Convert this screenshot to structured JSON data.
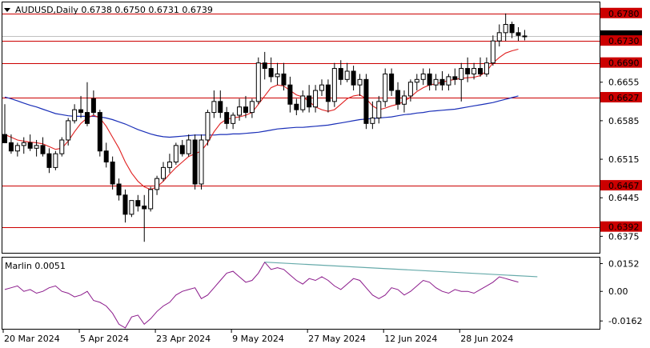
{
  "header": {
    "symbol_line": "AUDUSD,Daily  0.6738 0.6750 0.6731 0.6739"
  },
  "indicator": {
    "label": "Marlin 0.0051",
    "ticks": [
      0.0152,
      0.0,
      -0.0162
    ],
    "tick_labels": [
      "0.0152",
      "0.00",
      "-0.0162"
    ]
  },
  "chart_data": {
    "type": "candlestick",
    "ylim": [
      0.6345,
      0.68
    ],
    "price_ticks": [
      0.6655,
      0.6585,
      0.6515,
      0.6445,
      0.6375
    ],
    "price_tick_labels": [
      "0.6655",
      "0.6585",
      "0.6515",
      "0.6445",
      "0.6375"
    ],
    "current_price": 0.6739,
    "current_price_label": "0.6739",
    "levels": [
      {
        "value": 0.678,
        "label": "0.6780"
      },
      {
        "value": 0.673,
        "label": "0.6730"
      },
      {
        "value": 0.669,
        "label": "0.6690"
      },
      {
        "value": 0.6627,
        "label": "0.6627"
      },
      {
        "value": 0.6467,
        "label": "0.6467"
      },
      {
        "value": 0.6392,
        "label": "0.6392"
      }
    ],
    "x_labels": [
      "20 Mar 2024",
      "5 Apr 2024",
      "23 Apr 2024",
      "9 May 2024",
      "27 May 2024",
      "12 Jun 2024",
      "28 Jun 2024"
    ],
    "x_label_bars": [
      0,
      12,
      24,
      36,
      48,
      60,
      72
    ],
    "candles": [
      [
        0.656,
        0.6615,
        0.6545,
        0.6545
      ],
      [
        0.6545,
        0.656,
        0.6525,
        0.653
      ],
      [
        0.653,
        0.6545,
        0.652,
        0.654
      ],
      [
        0.654,
        0.6555,
        0.6525,
        0.6545
      ],
      [
        0.6545,
        0.656,
        0.653,
        0.6535
      ],
      [
        0.6535,
        0.655,
        0.652,
        0.654
      ],
      [
        0.654,
        0.6555,
        0.652,
        0.6525
      ],
      [
        0.6525,
        0.6535,
        0.649,
        0.65
      ],
      [
        0.65,
        0.653,
        0.6495,
        0.6525
      ],
      [
        0.6525,
        0.6555,
        0.652,
        0.655
      ],
      [
        0.655,
        0.659,
        0.654,
        0.6585
      ],
      [
        0.6585,
        0.6615,
        0.658,
        0.6605
      ],
      [
        0.6605,
        0.663,
        0.659,
        0.66
      ],
      [
        0.66,
        0.6655,
        0.6575,
        0.658
      ],
      [
        0.6625,
        0.664,
        0.6595,
        0.66
      ],
      [
        0.66,
        0.6605,
        0.652,
        0.653
      ],
      [
        0.653,
        0.6545,
        0.65,
        0.651
      ],
      [
        0.651,
        0.652,
        0.646,
        0.647
      ],
      [
        0.647,
        0.648,
        0.644,
        0.645
      ],
      [
        0.645,
        0.646,
        0.64,
        0.6415
      ],
      [
        0.6415,
        0.644,
        0.641,
        0.644
      ],
      [
        0.644,
        0.645,
        0.642,
        0.643
      ],
      [
        0.643,
        0.645,
        0.6365,
        0.6425
      ],
      [
        0.6425,
        0.6465,
        0.642,
        0.646
      ],
      [
        0.646,
        0.6485,
        0.645,
        0.648
      ],
      [
        0.648,
        0.651,
        0.6475,
        0.65
      ],
      [
        0.65,
        0.6525,
        0.649,
        0.651
      ],
      [
        0.651,
        0.6545,
        0.6505,
        0.654
      ],
      [
        0.654,
        0.655,
        0.652,
        0.6525
      ],
      [
        0.6525,
        0.656,
        0.652,
        0.655
      ],
      [
        0.655,
        0.656,
        0.646,
        0.647
      ],
      [
        0.647,
        0.656,
        0.646,
        0.655
      ],
      [
        0.655,
        0.6605,
        0.654,
        0.66
      ],
      [
        0.66,
        0.664,
        0.659,
        0.662
      ],
      [
        0.662,
        0.664,
        0.659,
        0.66
      ],
      [
        0.66,
        0.661,
        0.657,
        0.658
      ],
      [
        0.658,
        0.66,
        0.657,
        0.6595
      ],
      [
        0.6595,
        0.6625,
        0.6585,
        0.661
      ],
      [
        0.661,
        0.663,
        0.659,
        0.66
      ],
      [
        0.66,
        0.6625,
        0.659,
        0.662
      ],
      [
        0.662,
        0.67,
        0.6615,
        0.669
      ],
      [
        0.669,
        0.671,
        0.666,
        0.668
      ],
      [
        0.668,
        0.67,
        0.6655,
        0.6665
      ],
      [
        0.6665,
        0.669,
        0.665,
        0.667
      ],
      [
        0.667,
        0.669,
        0.664,
        0.665
      ],
      [
        0.665,
        0.6665,
        0.66,
        0.6615
      ],
      [
        0.6615,
        0.6625,
        0.6595,
        0.6605
      ],
      [
        0.6605,
        0.664,
        0.66,
        0.663
      ],
      [
        0.663,
        0.665,
        0.66,
        0.661
      ],
      [
        0.661,
        0.665,
        0.66,
        0.664
      ],
      [
        0.664,
        0.666,
        0.663,
        0.665
      ],
      [
        0.665,
        0.666,
        0.66,
        0.662
      ],
      [
        0.662,
        0.669,
        0.661,
        0.668
      ],
      [
        0.668,
        0.6695,
        0.665,
        0.666
      ],
      [
        0.666,
        0.669,
        0.6655,
        0.6675
      ],
      [
        0.6675,
        0.6685,
        0.664,
        0.665
      ],
      [
        0.665,
        0.667,
        0.663,
        0.666
      ],
      [
        0.666,
        0.667,
        0.657,
        0.658
      ],
      [
        0.658,
        0.662,
        0.657,
        0.659
      ],
      [
        0.659,
        0.663,
        0.658,
        0.662
      ],
      [
        0.662,
        0.668,
        0.661,
        0.667
      ],
      [
        0.667,
        0.668,
        0.663,
        0.664
      ],
      [
        0.664,
        0.6655,
        0.6605,
        0.6615
      ],
      [
        0.6615,
        0.664,
        0.66,
        0.663
      ],
      [
        0.663,
        0.666,
        0.662,
        0.6655
      ],
      [
        0.6655,
        0.667,
        0.664,
        0.666
      ],
      [
        0.666,
        0.668,
        0.665,
        0.667
      ],
      [
        0.667,
        0.668,
        0.664,
        0.665
      ],
      [
        0.665,
        0.667,
        0.664,
        0.666
      ],
      [
        0.666,
        0.6675,
        0.664,
        0.665
      ],
      [
        0.665,
        0.667,
        0.664,
        0.6665
      ],
      [
        0.6665,
        0.668,
        0.665,
        0.666
      ],
      [
        0.666,
        0.669,
        0.662,
        0.668
      ],
      [
        0.668,
        0.67,
        0.6655,
        0.667
      ],
      [
        0.667,
        0.669,
        0.666,
        0.668
      ],
      [
        0.668,
        0.67,
        0.6665,
        0.667
      ],
      [
        0.667,
        0.67,
        0.6665,
        0.669
      ],
      [
        0.669,
        0.674,
        0.6685,
        0.673
      ],
      [
        0.673,
        0.676,
        0.672,
        0.6745
      ],
      [
        0.6745,
        0.678,
        0.673,
        0.676
      ],
      [
        0.676,
        0.6765,
        0.6735,
        0.6745
      ],
      [
        0.6745,
        0.6755,
        0.673,
        0.674
      ],
      [
        0.6738,
        0.675,
        0.6731,
        0.6739
      ]
    ],
    "ma_fast": [
      0.656,
      0.6555,
      0.655,
      0.6548,
      0.6546,
      0.6545,
      0.6543,
      0.6538,
      0.6533,
      0.6535,
      0.6548,
      0.6565,
      0.658,
      0.659,
      0.6595,
      0.659,
      0.6575,
      0.6555,
      0.6535,
      0.651,
      0.649,
      0.6475,
      0.6465,
      0.646,
      0.6465,
      0.6475,
      0.6488,
      0.65,
      0.651,
      0.652,
      0.6525,
      0.653,
      0.6545,
      0.6565,
      0.658,
      0.6588,
      0.659,
      0.6592,
      0.6595,
      0.66,
      0.6615,
      0.663,
      0.6645,
      0.665,
      0.6648,
      0.664,
      0.6632,
      0.6628,
      0.662,
      0.661,
      0.6605,
      0.6602,
      0.6605,
      0.6615,
      0.6625,
      0.663,
      0.6632,
      0.6625,
      0.6612,
      0.6605,
      0.6608,
      0.6612,
      0.6615,
      0.662,
      0.6628,
      0.6638,
      0.6645,
      0.665,
      0.6652,
      0.6655,
      0.6658,
      0.666,
      0.6662,
      0.6663,
      0.6664,
      0.6667,
      0.6675,
      0.669,
      0.67,
      0.6708,
      0.6712,
      0.6715
    ],
    "ma_slow": [
      0.6628,
      0.6625,
      0.6621,
      0.6617,
      0.6613,
      0.661,
      0.6606,
      0.6602,
      0.6598,
      0.6596,
      0.6594,
      0.6593,
      0.6593,
      0.6593,
      0.6593,
      0.6592,
      0.659,
      0.6587,
      0.6583,
      0.6579,
      0.6574,
      0.6569,
      0.6565,
      0.6561,
      0.6558,
      0.6556,
      0.6555,
      0.6556,
      0.6557,
      0.6558,
      0.6559,
      0.6559,
      0.6559,
      0.6559,
      0.656,
      0.656,
      0.6561,
      0.6561,
      0.6562,
      0.6563,
      0.6564,
      0.6566,
      0.6568,
      0.657,
      0.6571,
      0.6572,
      0.6573,
      0.6573,
      0.6574,
      0.6575,
      0.6576,
      0.6577,
      0.6579,
      0.6581,
      0.6583,
      0.6585,
      0.6587,
      0.6588,
      0.6589,
      0.659,
      0.6591,
      0.6592,
      0.6594,
      0.6596,
      0.6597,
      0.6599,
      0.66,
      0.6602,
      0.6603,
      0.6604,
      0.6605,
      0.6606,
      0.6608,
      0.661,
      0.6612,
      0.6614,
      0.6616,
      0.6618,
      0.6621,
      0.6624,
      0.6627,
      0.663
    ],
    "indicator_values": [
      0.001,
      0.002,
      0.003,
      0.0,
      0.001,
      -0.001,
      0.0,
      0.002,
      0.003,
      0.0,
      -0.001,
      -0.003,
      -0.002,
      0.0,
      -0.005,
      -0.006,
      -0.008,
      -0.012,
      -0.018,
      -0.02,
      -0.014,
      -0.013,
      -0.018,
      -0.015,
      -0.011,
      -0.008,
      -0.006,
      -0.002,
      0.0,
      0.001,
      0.002,
      -0.004,
      -0.002,
      0.002,
      0.006,
      0.01,
      0.011,
      0.008,
      0.005,
      0.006,
      0.01,
      0.016,
      0.012,
      0.013,
      0.012,
      0.009,
      0.006,
      0.004,
      0.007,
      0.006,
      0.008,
      0.006,
      0.003,
      0.001,
      0.004,
      0.007,
      0.006,
      0.002,
      -0.002,
      -0.004,
      -0.002,
      0.002,
      0.001,
      -0.002,
      0.0,
      0.003,
      0.006,
      0.005,
      0.002,
      0.0,
      -0.001,
      0.001,
      0.0,
      0.0,
      -0.001,
      0.001,
      0.003,
      0.005,
      0.008,
      0.007,
      0.006,
      0.0051
    ],
    "indicator_trendline": [
      [
        41,
        0.016
      ],
      [
        84,
        0.008
      ]
    ]
  },
  "colors": {
    "bull": "#ffffff",
    "bear": "#000000",
    "level_line": "#cc0000",
    "level_label_bg": "#cc0000",
    "ma_fast": "#e02020",
    "ma_slow": "#1a2fb8",
    "indicator": "#8b1a8b",
    "trendline": "#66aaaa",
    "price_label_bg": "#000000"
  }
}
